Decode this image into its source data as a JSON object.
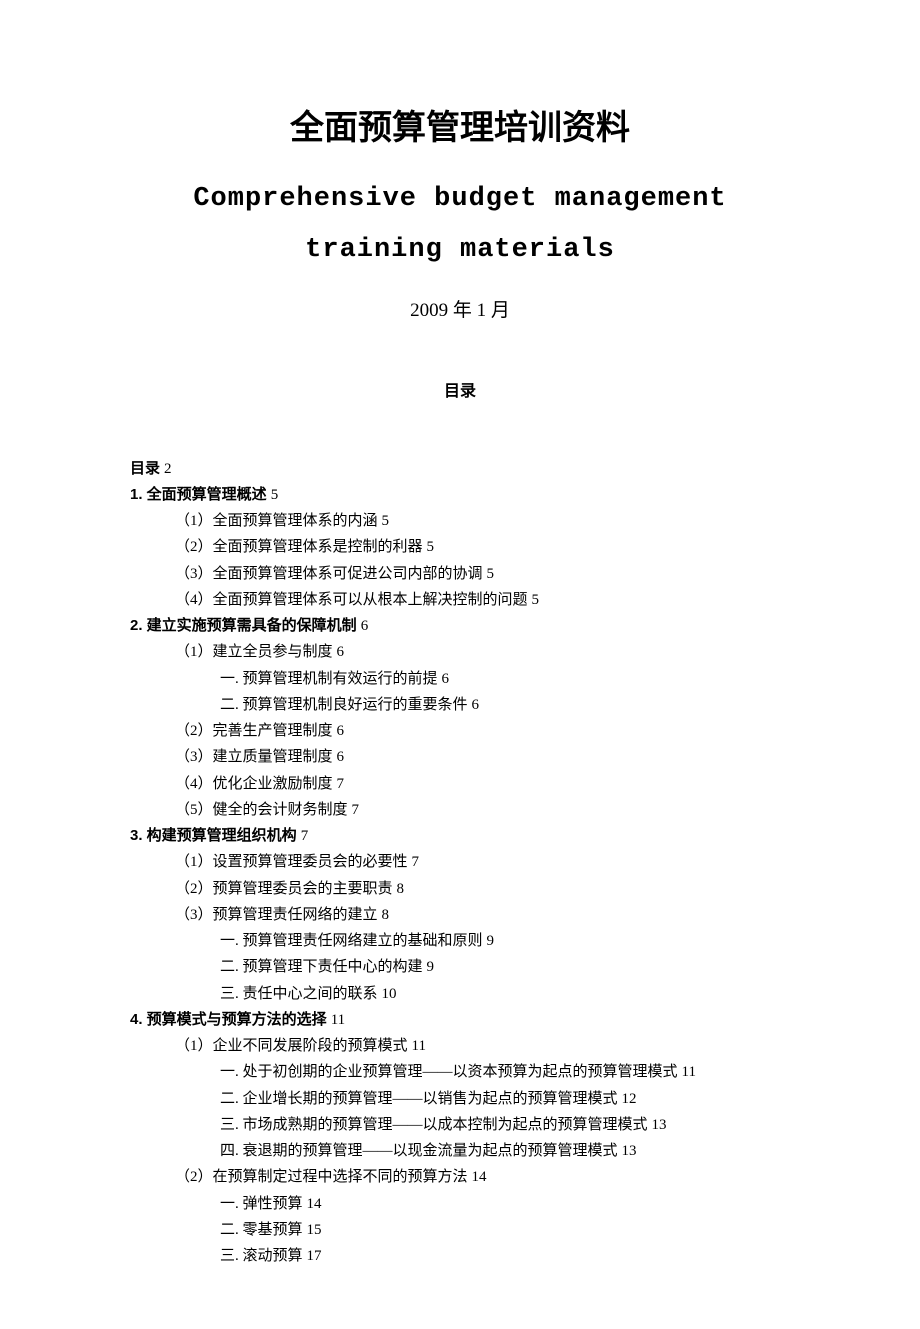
{
  "title_cn": "全面预算管理培训资料",
  "title_en": "Comprehensive budget management training materials",
  "date": "2009 年 1 月",
  "toc_label": "目录",
  "toc": [
    {
      "lvl": 0,
      "text": "目录",
      "page": "2"
    },
    {
      "lvl": 0,
      "text": "1. 全面预算管理概述",
      "page": "5"
    },
    {
      "lvl": 1,
      "text": "（1）全面预算管理体系的内涵",
      "page": "5"
    },
    {
      "lvl": 1,
      "text": "（2）全面预算管理体系是控制的利器",
      "page": "5"
    },
    {
      "lvl": 1,
      "text": "（3）全面预算管理体系可促进公司内部的协调",
      "page": "5"
    },
    {
      "lvl": 1,
      "text": "（4）全面预算管理体系可以从根本上解决控制的问题",
      "page": "5"
    },
    {
      "lvl": 0,
      "text": "2. 建立实施预算需具备的保障机制",
      "page": "6"
    },
    {
      "lvl": 1,
      "text": "（1）建立全员参与制度",
      "page": "6"
    },
    {
      "lvl": 2,
      "text": "一. 预算管理机制有效运行的前提",
      "page": "6"
    },
    {
      "lvl": 2,
      "text": "二. 预算管理机制良好运行的重要条件",
      "page": "6"
    },
    {
      "lvl": 1,
      "text": "（2）完善生产管理制度",
      "page": "6"
    },
    {
      "lvl": 1,
      "text": "（3）建立质量管理制度",
      "page": "6"
    },
    {
      "lvl": 1,
      "text": "（4）优化企业激励制度",
      "page": "7"
    },
    {
      "lvl": 1,
      "text": "（5）健全的会计财务制度",
      "page": "7"
    },
    {
      "lvl": 0,
      "text": "3. 构建预算管理组织机构",
      "page": "7"
    },
    {
      "lvl": 1,
      "text": "（1）设置预算管理委员会的必要性",
      "page": "7"
    },
    {
      "lvl": 1,
      "text": "（2）预算管理委员会的主要职责",
      "page": "8"
    },
    {
      "lvl": 1,
      "text": "（3）预算管理责任网络的建立",
      "page": "8"
    },
    {
      "lvl": 2,
      "text": "一. 预算管理责任网络建立的基础和原则",
      "page": "9"
    },
    {
      "lvl": 2,
      "text": "二. 预算管理下责任中心的构建",
      "page": "9"
    },
    {
      "lvl": 2,
      "text": "三. 责任中心之间的联系",
      "page": "10"
    },
    {
      "lvl": 0,
      "text": "4. 预算模式与预算方法的选择",
      "page": "11"
    },
    {
      "lvl": 1,
      "text": "（1）企业不同发展阶段的预算模式",
      "page": "11"
    },
    {
      "lvl": 2,
      "text": "一. 处于初创期的企业预算管理——以资本预算为起点的预算管理模式",
      "page": "11"
    },
    {
      "lvl": 2,
      "text": "二. 企业增长期的预算管理——以销售为起点的预算管理模式",
      "page": "12"
    },
    {
      "lvl": 2,
      "text": "三. 市场成熟期的预算管理——以成本控制为起点的预算管理模式",
      "page": "13"
    },
    {
      "lvl": 2,
      "text": "四. 衰退期的预算管理——以现金流量为起点的预算管理模式",
      "page": "13"
    },
    {
      "lvl": 1,
      "text": "（2）在预算制定过程中选择不同的预算方法",
      "page": "14"
    },
    {
      "lvl": 2,
      "text": "一. 弹性预算",
      "page": "14"
    },
    {
      "lvl": 2,
      "text": "二. 零基预算",
      "page": "15"
    },
    {
      "lvl": 2,
      "text": "三. 滚动预算",
      "page": "17"
    }
  ]
}
